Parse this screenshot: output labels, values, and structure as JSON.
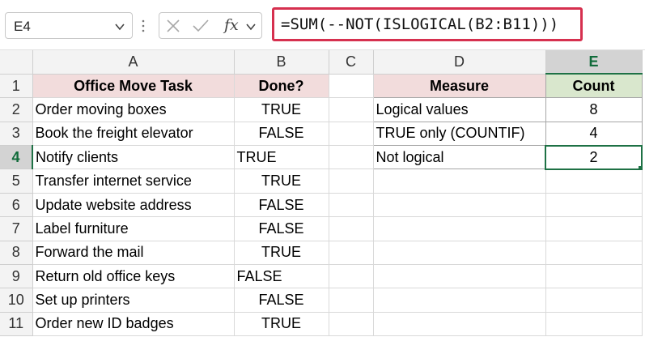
{
  "name_box": {
    "value": "E4"
  },
  "formula_bar": {
    "fx_label": "fx",
    "formula": "=SUM(--NOT(ISLOGICAL(B2:B11)))"
  },
  "columns": [
    "A",
    "B",
    "C",
    "D",
    "E"
  ],
  "rows": [
    "1",
    "2",
    "3",
    "4",
    "5",
    "6",
    "7",
    "8",
    "9",
    "10",
    "11"
  ],
  "task_table": {
    "header_task": "Office Move Task",
    "header_done": "Done?",
    "items": [
      {
        "task": "Order moving boxes",
        "done": "TRUE"
      },
      {
        "task": "Book the freight elevator",
        "done": "FALSE"
      },
      {
        "task": "Notify clients",
        "done": "TRUE"
      },
      {
        "task": "Transfer internet service",
        "done": "TRUE"
      },
      {
        "task": "Update website address",
        "done": "FALSE"
      },
      {
        "task": "Label furniture",
        "done": "FALSE"
      },
      {
        "task": "Forward the mail",
        "done": "TRUE"
      },
      {
        "task": "Return old office keys",
        "done": "FALSE"
      },
      {
        "task": "Set up printers",
        "done": "FALSE"
      },
      {
        "task": "Order new ID badges",
        "done": "TRUE"
      }
    ]
  },
  "summary_table": {
    "header_measure": "Measure",
    "header_count": "Count",
    "items": [
      {
        "measure": "Logical values",
        "count": "8"
      },
      {
        "measure": "TRUE only (COUNTIF)",
        "count": "4"
      },
      {
        "measure": "Not logical",
        "count": "2"
      }
    ]
  },
  "colors": {
    "accent_green": "#1e7145",
    "formula_highlight": "#d6304f",
    "header_pink": "#f2dcdc",
    "header_green": "#d9e7cd"
  }
}
